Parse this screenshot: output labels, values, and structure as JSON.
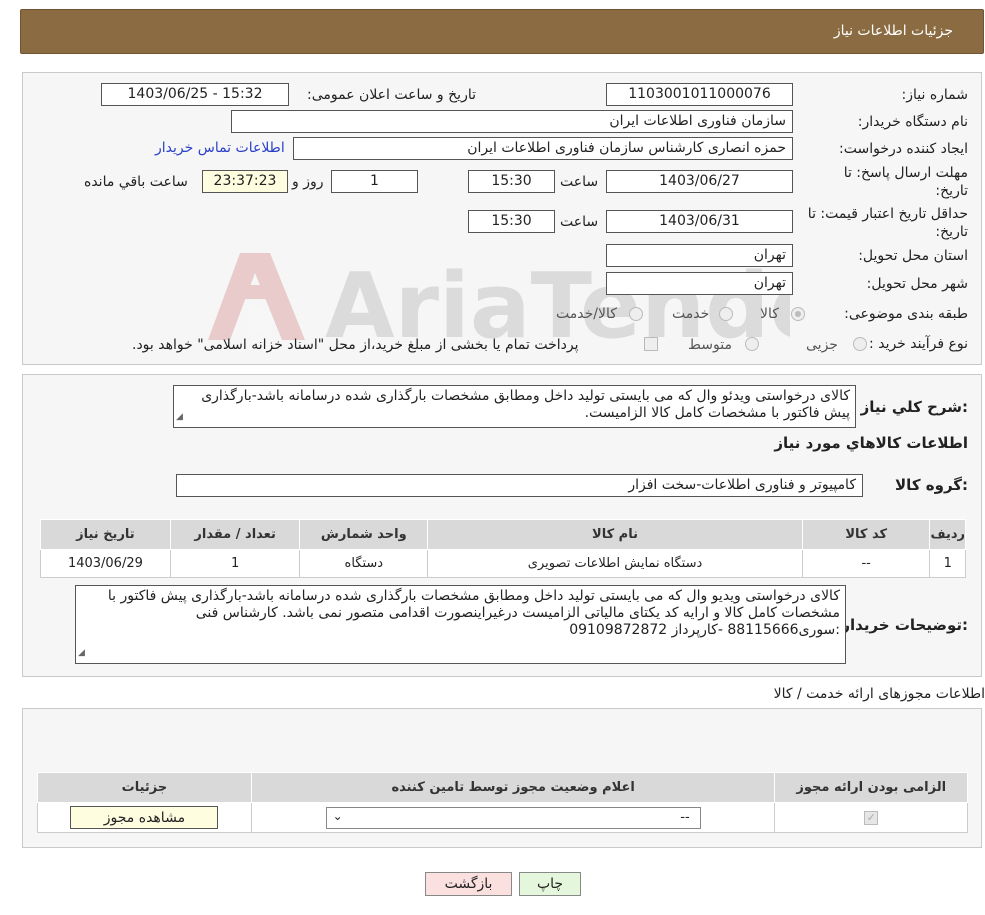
{
  "header": {
    "title": "جزئیات اطلاعات نیاز"
  },
  "form": {
    "need_number_label": "شماره نیاز:",
    "need_number": "1103001011000076",
    "announce_label": "تاریخ و ساعت اعلان عمومی:",
    "announce_value": "1403/06/25 - 15:32",
    "buyer_org_label": "نام دستگاه خریدار:",
    "buyer_org": "سازمان فناوری اطلاعات ایران",
    "requester_label": "ایجاد کننده درخواست:",
    "requester": "حمزه انصاری کارشناس سازمان فناوری اطلاعات ایران",
    "contact_link": "اطلاعات تماس خریدار",
    "deadline_label_1": "مهلت ارسال پاسخ: تا",
    "deadline_label_2": "تاریخ:",
    "deadline_date": "1403/06/27",
    "time_label": "ساعت",
    "deadline_time": "15:30",
    "days_value": "1",
    "days_label": "روز و",
    "remaining_time": "23:37:23",
    "remaining_label": "ساعت باقي مانده",
    "validity_label_1": "حداقل تاریخ اعتبار قیمت: تا",
    "validity_label_2": "تاریخ:",
    "validity_date": "1403/06/31",
    "validity_time": "15:30",
    "province_label": "استان محل تحویل:",
    "province": "تهران",
    "city_label": "شهر محل تحویل:",
    "city": "تهران",
    "category_label": "طبقه بندی موضوعی:",
    "category_options": [
      "کالا",
      "خدمت",
      "کالا/خدمت"
    ],
    "process_label": "نوع فرآیند خرید :",
    "process_options": [
      "جزیی",
      "متوسط"
    ],
    "payment_note": "پرداخت تمام یا بخشی از مبلغ خرید،از محل \"اسناد خزانه اسلامی\" خواهد بود."
  },
  "details": {
    "description_label": "شرح کلي نياز:",
    "description": "کالای درخواستی ویدئو وال که می بایستی تولید داخل ومطابق مشخصات بارگذاری شده درسامانه باشد-بارگذاری پیش فاکتور با مشخصات کامل کالا الزامیست.",
    "goods_info_title": "اطلاعات کالاهاي مورد نياز",
    "goods_group_label": "گروه کالا:",
    "goods_group": "کامپیوتر و فناوری اطلاعات-سخت افزار",
    "table_headers": [
      "رديف",
      "کد کالا",
      "نام کالا",
      "واحد شمارش",
      "تعداد / مقدار",
      "تاريخ نياز"
    ],
    "table_rows": [
      [
        "1",
        "--",
        "دستگاه نمایش اطلاعات تصویری",
        "دستگاه",
        "1",
        "1403/06/29"
      ]
    ],
    "buyer_notes_label": "توضیحات خریدار:",
    "buyer_notes": "کالای درخواستی ویدیو وال که می بایستی تولید داخل ومطابق مشخصات بارگذاری شده درسامانه باشد-بارگذاری پیش فاکتور با مشخصات کامل کالا و ارایه کد یکتای مالیاتی الزامیست درغیراینصورت اقدامی متصور نمی باشد. کارشناس فنی :سوری88115666 -کارپرداز 09109872872"
  },
  "permits": {
    "title": "اطلاعات مجوزهای ارائه خدمت / کالا",
    "headers": [
      "الزامی بودن ارائه مجوز",
      "اعلام وضعیت مجوز توسط تامین کننده",
      "جزئیات"
    ],
    "select_value": "--",
    "view_button": "مشاهده مجوز"
  },
  "buttons": {
    "print": "چاپ",
    "back": "بازگشت"
  },
  "watermark": {
    "text": "AriaTender.neT"
  }
}
